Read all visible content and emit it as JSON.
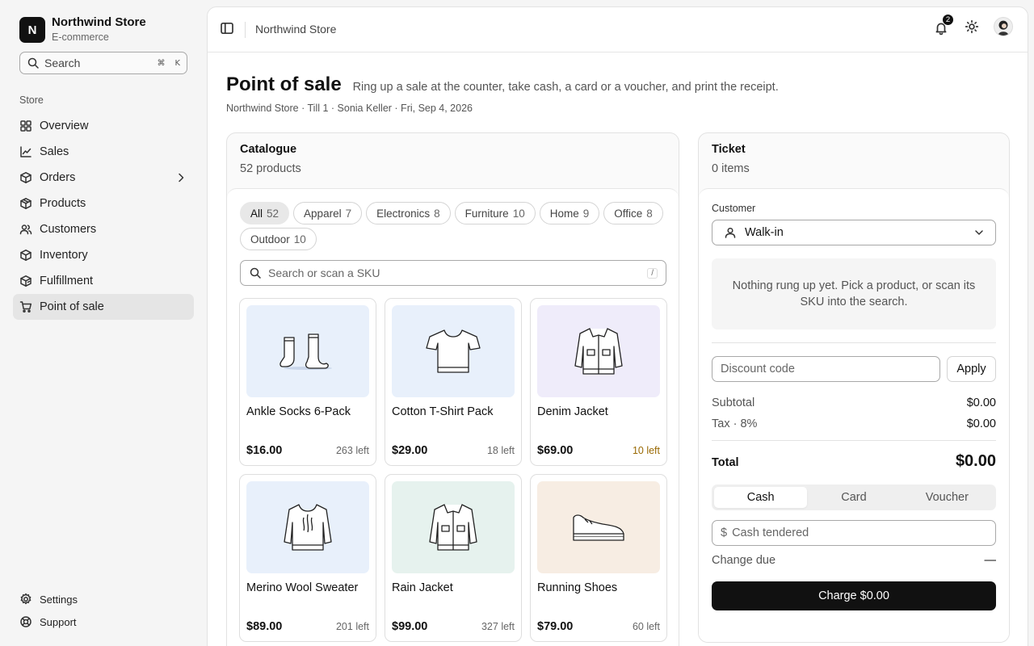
{
  "app": {
    "brand_initial": "N",
    "name": "Northwind Store",
    "subtitle": "E-commerce"
  },
  "sidebar": {
    "search_placeholder": "Search",
    "search_shortcut": [
      "⌘",
      "K"
    ],
    "section_label": "Store",
    "items": [
      {
        "label": "Overview",
        "icon": "grid-icon"
      },
      {
        "label": "Sales",
        "icon": "chart-line-icon"
      },
      {
        "label": "Orders",
        "icon": "box-icon"
      },
      {
        "label": "Products",
        "icon": "package-icon"
      },
      {
        "label": "Customers",
        "icon": "users-icon"
      },
      {
        "label": "Inventory",
        "icon": "package-icon"
      },
      {
        "label": "Fulfillment",
        "icon": "truck-box-icon"
      },
      {
        "label": "Point of sale",
        "icon": "cart-icon"
      }
    ],
    "active": "Point of sale",
    "bottom": [
      {
        "label": "Settings",
        "icon": "gear-icon"
      },
      {
        "label": "Support",
        "icon": "lifebuoy-icon"
      }
    ]
  },
  "topbar": {
    "breadcrumb": "Northwind Store",
    "notification_count": "2"
  },
  "page": {
    "title": "Point of sale",
    "description": "Ring up a sale at the counter, take cash, a card or a voucher, and print the receipt.",
    "meta": "Northwind Store · Till 1 · Sonia Keller · Fri, Sep 4, 2026"
  },
  "catalogue": {
    "title": "Catalogue",
    "subtitle": "52 products",
    "chips": [
      {
        "label": "All",
        "count": "52"
      },
      {
        "label": "Apparel",
        "count": "7"
      },
      {
        "label": "Electronics",
        "count": "8"
      },
      {
        "label": "Furniture",
        "count": "10"
      },
      {
        "label": "Home",
        "count": "9"
      },
      {
        "label": "Office",
        "count": "8"
      },
      {
        "label": "Outdoor",
        "count": "10"
      }
    ],
    "active_chip": "All",
    "search_placeholder": "Search or scan a SKU",
    "search_shortcut": "/",
    "products": [
      {
        "name": "Ankle Socks 6-Pack",
        "price": "$16.00",
        "stock": "263 left",
        "low": false,
        "bg": "#e8f0fb",
        "icon": "socks-icon"
      },
      {
        "name": "Cotton T-Shirt Pack",
        "price": "$29.00",
        "stock": "18 left",
        "low": false,
        "bg": "#e8f0fb",
        "icon": "tshirt-icon"
      },
      {
        "name": "Denim Jacket",
        "price": "$69.00",
        "stock": "10 left",
        "low": true,
        "bg": "#efecfa",
        "icon": "jacket-icon"
      },
      {
        "name": "Merino Wool Sweater",
        "price": "$89.00",
        "stock": "201 left",
        "low": false,
        "bg": "#e8f0fb",
        "icon": "sweater-icon"
      },
      {
        "name": "Rain Jacket",
        "price": "$99.00",
        "stock": "327 left",
        "low": false,
        "bg": "#e6f2ee",
        "icon": "jacket-icon"
      },
      {
        "name": "Running Shoes",
        "price": "$79.00",
        "stock": "60 left",
        "low": false,
        "bg": "#f7ede3",
        "icon": "shoe-icon"
      }
    ]
  },
  "ticket": {
    "title": "Ticket",
    "subtitle": "0 items",
    "customer_label": "Customer",
    "customer_value": "Walk-in",
    "empty_text": "Nothing rung up yet. Pick a product, or scan its SKU into the search.",
    "discount_placeholder": "Discount code",
    "apply_label": "Apply",
    "subtotal_label": "Subtotal",
    "subtotal": "$0.00",
    "tax_label": "Tax · 8%",
    "tax": "$0.00",
    "total_label": "Total",
    "total": "$0.00",
    "payment_methods": [
      "Cash",
      "Card",
      "Voucher"
    ],
    "active_method": "Cash",
    "currency_symbol": "$",
    "cash_placeholder": "Cash tendered",
    "change_label": "Change due",
    "change_value": "—",
    "charge_label": "Charge $0.00"
  },
  "colors": {
    "accent": "#111111",
    "low_stock": "#9a6a05"
  }
}
